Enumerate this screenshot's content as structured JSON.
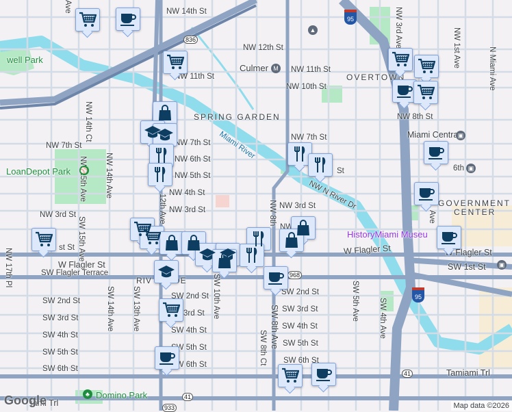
{
  "colors": {
    "background": "#f3f1f4",
    "water": "#8fdcec",
    "park": "#b5e8c4",
    "highway": "#8ea4c2",
    "road": "#ffffff",
    "marker_fill": "#dde8fb",
    "marker_icon": "#0d3e62"
  },
  "streets": {
    "nw14th_st": "NW 14th St",
    "nw12th_st": "NW 12th St",
    "nw11th_st_e": "NW 11th St",
    "nw11th_st_w": "NW 11th St",
    "nw10th_st": "NW 10th St",
    "nw8th_st": "NW 8th St",
    "nw7th_st_w": "NW 7th St",
    "nw7th_st_m": "NW 7th St",
    "nw7th_st_e": "NW 7th St",
    "nw6th_st": "NW 6th St",
    "nw6th_st_e": "6th St",
    "nw5th_st": "NW 5th St",
    "nw5th_st_e": "St",
    "nw4th_st": "NW 4th St",
    "nw3rd_st_w": "NW 3rd St",
    "nw3rd_st_m": "NW 3rd St",
    "nw3rd_st_e": "NW 3rd St",
    "nw_n_river_dr": "NW N River Dr",
    "nw_1st_st": "NW",
    "nw_1st_st_w": "st St",
    "w_flagler": "W Flagler St",
    "w_flagler_e": "W Flagler St",
    "sw_flagler_terrace": "SW Flagler Terrace",
    "sw1st_st": "SW 1st St",
    "sw2nd_w": "SW 2nd St",
    "sw2nd_m": "SW 2nd St",
    "sw2nd_e": "SW 2nd St",
    "sw3rd_w": "SW 3rd St",
    "sw3rd_m": "3rd St",
    "sw3rd_e": "SW 3rd St",
    "sw4th_w": "SW 4th St",
    "sw4th_m": "SW 4th St",
    "sw4th_e": "SW 4th St",
    "sw5th_w": "SW 5th St",
    "sw5th_m": "SW 5th St",
    "sw5th_e": "SW 5th St",
    "sw6th_w": "SW 6th St",
    "sw6th_m": "SW 6th St",
    "sw6th_e": "SW 6th St",
    "tamiami": "Tamiami Trl",
    "tamiami_w": "iami Trl",
    "nw14th_ct": "NW 14th Ct",
    "nw14th_ave": "NW 14th Ave",
    "nw15th_ave": "NW 15th Ave",
    "nw17th_pl": "NW 17th Pl",
    "nw12th_ave": "12th Ave",
    "nw10th_ave_top": "Ave",
    "sw15th_ave": "SW 15th Ave",
    "sw14th_ave": "SW 14th Ave",
    "sw13th_ave": "SW 13th Ave",
    "sw10th_ave": "SW 10th Ave",
    "sw8th_ave": "SW 8th Ave",
    "sw8th_ct": "SW 8th Ct",
    "nw8th_ave": "NW 8th",
    "sw5th_ave": "SW 5th Ave",
    "sw4th_ave": "SW 4th Ave",
    "nw3rd_ave": "NW 3rd Ave",
    "nw1st_ave": "NW 1st Ave",
    "n_miami_ave": "N Miami Ave",
    "nw_ave": "Ave",
    "rive": "RIV",
    "rive2": "DE"
  },
  "areas": {
    "spring_garden": "SPRING GARDEN",
    "overtown": "OVERTOWN",
    "government_center": "GOVERNMENT",
    "government_center2": "CENTER",
    "culmer": "Culmer",
    "miami_central": "Miami Central"
  },
  "parks": {
    "loandepot": "LoanDepot Park",
    "well_park": "well Park",
    "domino": "Domino Park"
  },
  "water": {
    "miami_river": "Miami River"
  },
  "poi": {
    "history_miami": "HistoryMiami Museu"
  },
  "shields": {
    "sr836": "836",
    "sr968a": "968",
    "i95": "95",
    "i95b": "95",
    "us41": "41",
    "us41b": "41",
    "sr933": "933"
  },
  "markers": [
    "cart",
    "cup",
    "cart",
    "bag",
    "grad",
    "grad",
    "utensils",
    "utensils",
    "cart",
    "cart",
    "cup",
    "cart",
    "utensils",
    "utensils",
    "cup",
    "cup",
    "cart",
    "cart",
    "cart",
    "bag",
    "bag",
    "grad",
    "grad",
    "bag",
    "bag",
    "utensils",
    "utensils",
    "bag",
    "grad",
    "cup",
    "cup",
    "cart",
    "cup",
    "cart",
    "cup"
  ],
  "footer": {
    "google": "Google",
    "attribution": "Map data ©2026"
  }
}
